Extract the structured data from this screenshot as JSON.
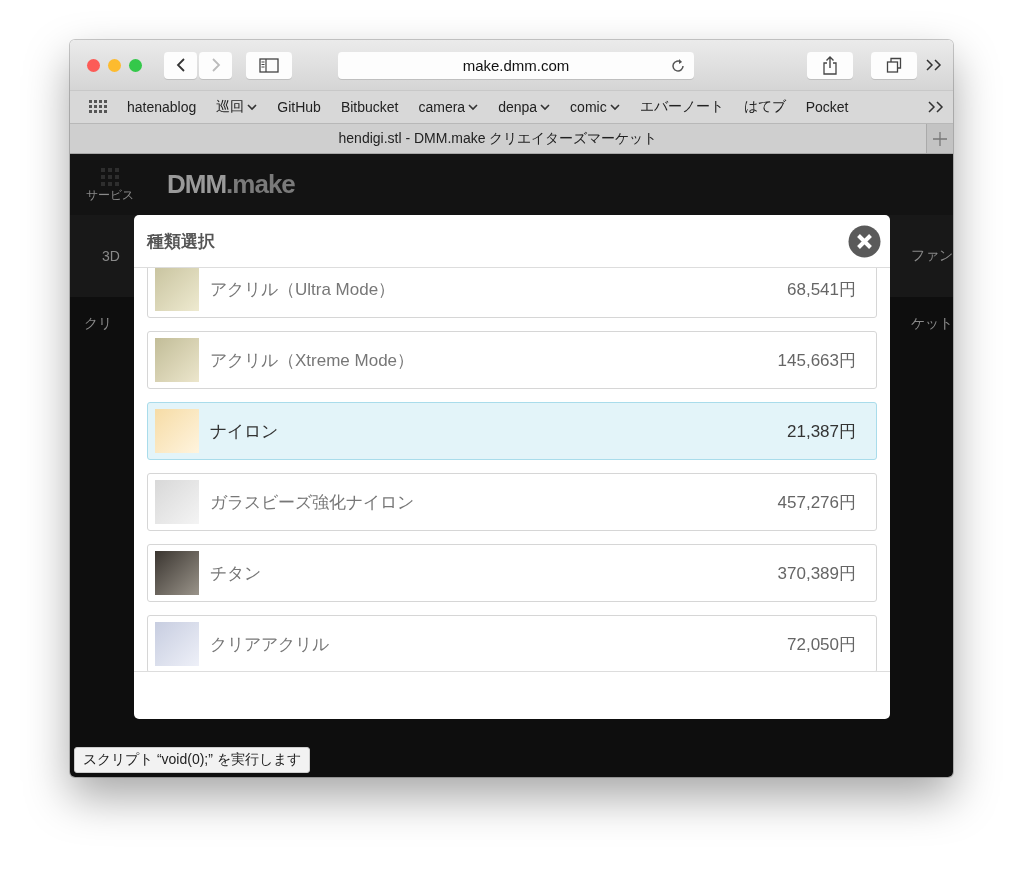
{
  "browser": {
    "url": "make.dmm.com",
    "bookmarks": [
      {
        "label": "hatenablog",
        "menu": false
      },
      {
        "label": "巡回",
        "menu": true
      },
      {
        "label": "GitHub",
        "menu": false
      },
      {
        "label": "Bitbucket",
        "menu": false
      },
      {
        "label": "camera",
        "menu": true
      },
      {
        "label": "denpa",
        "menu": true
      },
      {
        "label": "comic",
        "menu": true
      },
      {
        "label": "エバーノート",
        "menu": false
      },
      {
        "label": "はてブ",
        "menu": false
      },
      {
        "label": "Pocket",
        "menu": false
      }
    ],
    "tab_title": "hendigi.stl - DMM.make クリエイターズマーケット"
  },
  "page": {
    "service_label": "サービス",
    "logo": "DMM",
    "logo_suffix": ".make",
    "nav_left": "3D",
    "nav_right": "ファン",
    "breadcrumb_left": "クリ",
    "breadcrumb_right": "ケット"
  },
  "dialog": {
    "title": "種類選択",
    "items": [
      {
        "name": "アクリル（Ultra Mode）",
        "price": "68,541円",
        "selected": false
      },
      {
        "name": "アクリル（Xtreme Mode）",
        "price": "145,663円",
        "selected": false
      },
      {
        "name": "ナイロン",
        "price": "21,387円",
        "selected": true
      },
      {
        "name": "ガラスビーズ強化ナイロン",
        "price": "457,276円",
        "selected": false
      },
      {
        "name": "チタン",
        "price": "370,389円",
        "selected": false
      },
      {
        "name": "クリアアクリル",
        "price": "72,050円",
        "selected": false
      }
    ]
  },
  "status": "スクリプト “void(0);” を実行します"
}
